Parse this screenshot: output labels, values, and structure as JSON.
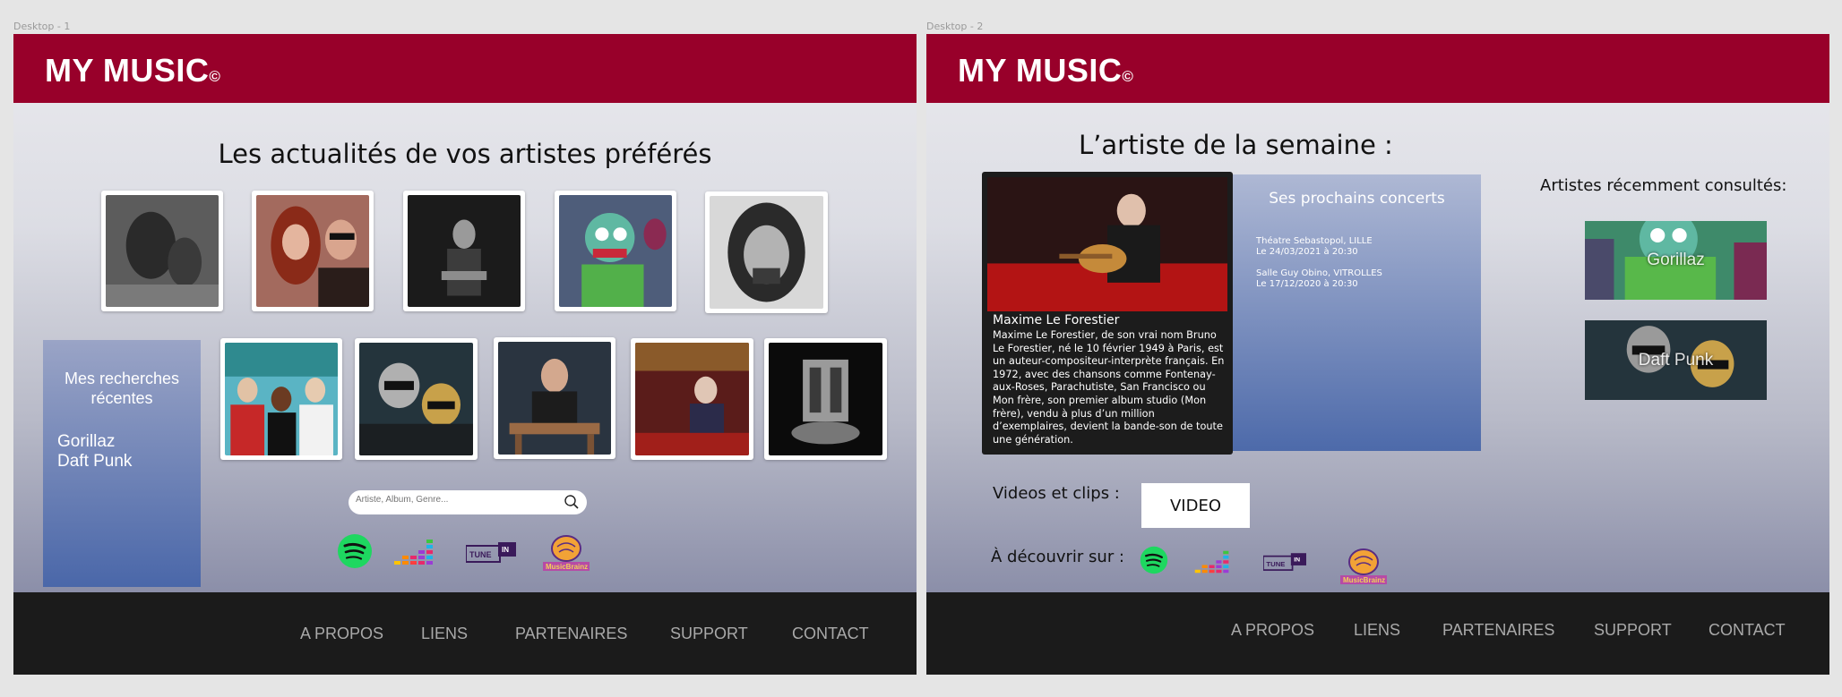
{
  "frames": {
    "frame1_label": "Desktop - 1",
    "frame2_label": "Desktop - 2"
  },
  "brand": {
    "title": "MY MUSIC",
    "mark": "©",
    "color": "#98002a"
  },
  "footer": {
    "links": [
      "A PROPOS",
      "LIENS",
      "PARTENAIRES",
      "SUPPORT",
      "CONTACT"
    ]
  },
  "desktop1": {
    "heading": "Les actualités de vos artistes préférés",
    "recent_searches": {
      "title_line1": "Mes recherches",
      "title_line2": "récentes",
      "items": [
        "Gorillaz",
        "Daft Punk"
      ]
    },
    "search": {
      "placeholder": "Artiste, Album, Genre..."
    },
    "services": [
      "spotify-icon",
      "deezer-icon",
      "tunein-icon",
      "musicbrainz-icon"
    ]
  },
  "desktop2": {
    "heading": "L’artiste de la semaine :",
    "artist": {
      "name": "Maxime Le Forestier",
      "bio": "Maxime Le Forestier, de son vrai nom Bruno Le Forestier, né le 10 février 1949 à Paris, est un auteur-compositeur-interprète français. En 1972, avec des chansons comme Fontenay-aux-Roses, Parachutiste, San Francisco ou Mon frère, son premier album studio (Mon frère), vendu à plus d’un million d’exemplaires, devient la bande-son de toute une génération."
    },
    "concerts": {
      "title": "Ses prochains concerts",
      "list": [
        {
          "venue": "Théatre Sebastopol, LILLE",
          "date": "Le 24/03/2021 à 20:30"
        },
        {
          "venue": "Salle Guy Obino, VITROLLES",
          "date": "Le 17/12/2020 à 20:30"
        }
      ]
    },
    "recently_viewed": {
      "title": "Artistes récemment consultés:",
      "items": [
        "Gorillaz",
        "Daft Punk"
      ]
    },
    "videos": {
      "label": "Videos et clips :",
      "button": "VIDEO"
    },
    "discover": {
      "label": "À découvrir sur :"
    }
  }
}
